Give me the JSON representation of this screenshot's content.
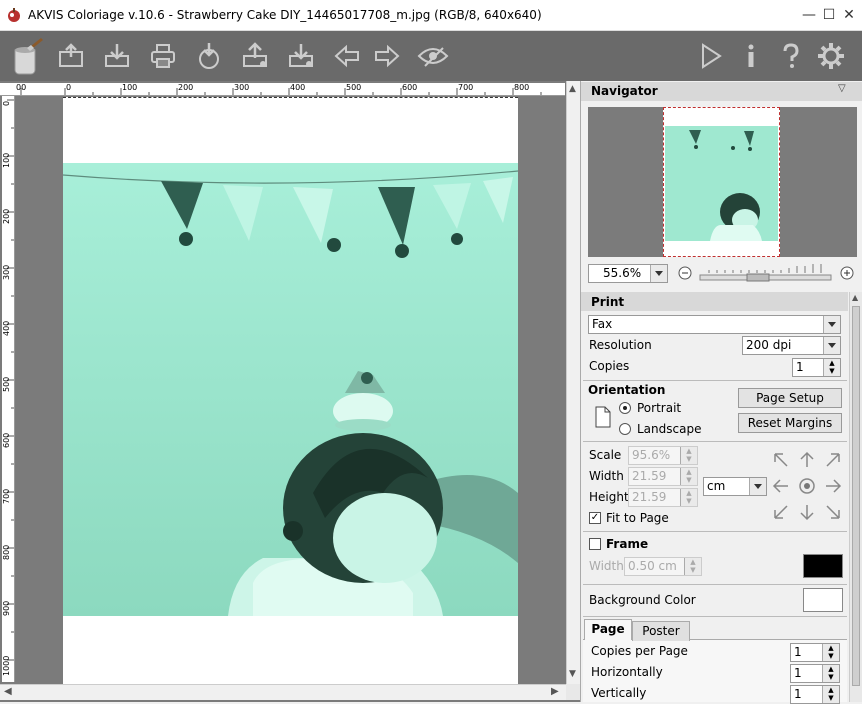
{
  "window": {
    "title": "AKVIS Coloriage v.10.6 - Strawberry Cake DIY_14465017708_m.jpg (RGB/8, 640x640)",
    "minimize": "—",
    "maximize": "☐",
    "close": "✕"
  },
  "toolbar": {
    "left_icons": [
      "paint-bucket-icon",
      "open-icon",
      "save-icon",
      "print-icon",
      "import-icon",
      "export-icon",
      "share-icon",
      "undo-arrow-icon",
      "redo-arrow-icon",
      "eye-preview-icon"
    ],
    "right_icons": [
      "play-icon",
      "info-icon",
      "help-icon",
      "gear-icon"
    ]
  },
  "rulers": {
    "horizontal": [
      "00",
      "0",
      "100",
      "200",
      "300",
      "400",
      "500",
      "600",
      "700",
      "800"
    ],
    "vertical": [
      "0",
      "100",
      "200",
      "300",
      "400",
      "500",
      "600",
      "700",
      "800",
      "900",
      "1000"
    ]
  },
  "navigator": {
    "title": "Navigator",
    "zoom": "55.6%"
  },
  "print": {
    "title": "Print",
    "printer": "Fax",
    "resolution_label": "Resolution",
    "resolution": "200 dpi",
    "copies_label": "Copies",
    "copies": "1"
  },
  "orientation": {
    "title": "Orientation",
    "portrait": "Portrait",
    "landscape": "Landscape",
    "selected": "Portrait",
    "page_setup": "Page Setup",
    "reset_margins": "Reset Margins"
  },
  "scale": {
    "scale_label": "Scale",
    "scale": "95.6%",
    "width_label": "Width",
    "width": "21.59",
    "height_label": "Height",
    "height": "21.59",
    "unit": "cm",
    "fit_label": "Fit to Page",
    "fit_checked": true
  },
  "frame": {
    "title": "Frame",
    "checked": false,
    "width_label": "Width",
    "width": "0.50 cm",
    "color": "#000000"
  },
  "background": {
    "label": "Background Color",
    "color": "#ffffff"
  },
  "tabs": {
    "page": "Page",
    "poster": "Poster",
    "active": "Page"
  },
  "page_tab": {
    "copies_per_page_label": "Copies per Page",
    "copies_per_page": "1",
    "horizontally_label": "Horizontally",
    "horizontally": "1",
    "vertically_label": "Vertically",
    "vertically": "1"
  }
}
